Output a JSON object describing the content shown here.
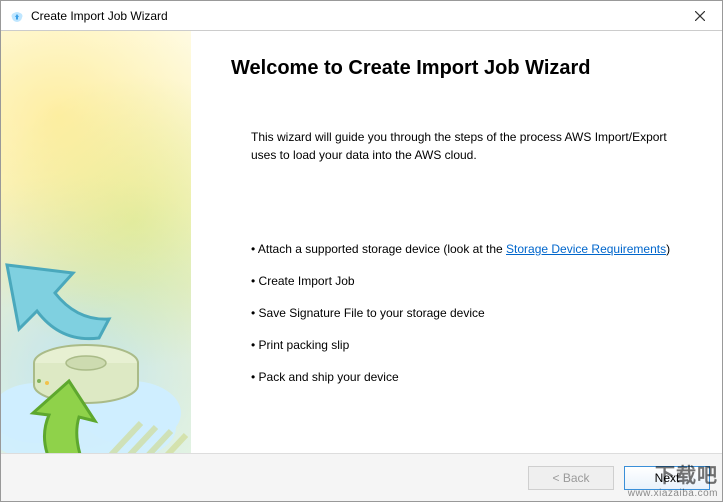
{
  "window": {
    "title": "Create Import Job Wizard"
  },
  "content": {
    "heading": "Welcome to Create Import Job Wizard",
    "intro": "This wizard will guide you through the steps of the process AWS Import/Export uses to load your data into the AWS cloud.",
    "steps": [
      {
        "prefix": "Attach a supported storage device (look at the ",
        "link": "Storage Device Requirements",
        "suffix": ")"
      },
      {
        "prefix": "Create Import Job",
        "link": "",
        "suffix": ""
      },
      {
        "prefix": "Save Signature File to your storage device",
        "link": "",
        "suffix": ""
      },
      {
        "prefix": "Print packing slip",
        "link": "",
        "suffix": ""
      },
      {
        "prefix": "Pack and ship your device",
        "link": "",
        "suffix": ""
      }
    ]
  },
  "footer": {
    "back": "< Back",
    "next": "Next"
  },
  "watermark": {
    "main": "下载吧",
    "sub": "www.xiazaiba.com"
  }
}
